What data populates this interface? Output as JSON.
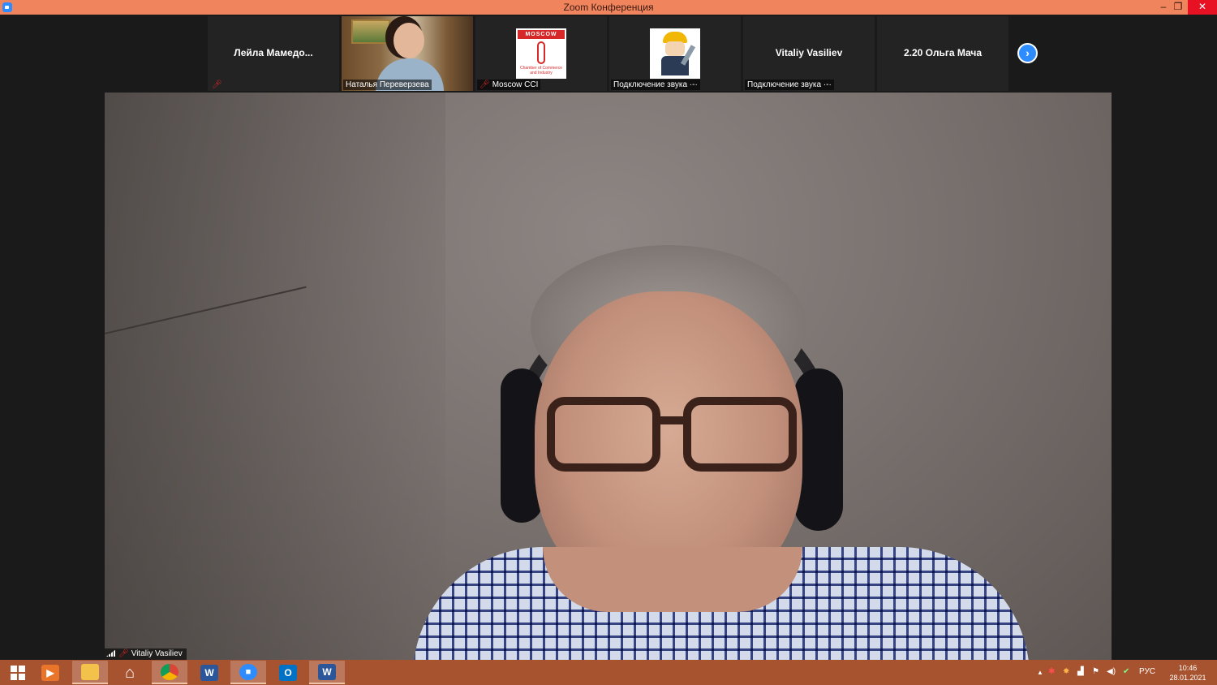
{
  "window": {
    "title": "Zoom Конференция",
    "controls": {
      "minimize": "‒",
      "restore": "❐",
      "close": "✕"
    }
  },
  "participants": [
    {
      "name": "Лейла  Мамедо...",
      "footer": "",
      "muted": true,
      "type": "name-only"
    },
    {
      "name": "Наталья Переверзева",
      "footer": "Наталья Переверзева",
      "muted": false,
      "type": "video"
    },
    {
      "name": "Moscow CCI",
      "footer": "Moscow CCI",
      "muted": true,
      "type": "logo",
      "logo_text": "MOSCOW",
      "logo_caption": "Chamber of Commerce and Industry"
    },
    {
      "name": "",
      "footer": "Подключение звука ·-·",
      "muted": false,
      "type": "logo"
    },
    {
      "name": "Vitaliy Vasiliev",
      "footer": "Подключение звука ·-·",
      "muted": false,
      "type": "name-only"
    },
    {
      "name": "2.20 Ольга Мача",
      "footer": "",
      "muted": false,
      "type": "name-only"
    }
  ],
  "next_page_icon": "›",
  "active_speaker": {
    "name": "Vitaliy Vasiliev",
    "muted": true
  },
  "taskbar": {
    "apps": [
      "windows-start",
      "media-player",
      "file-explorer",
      "home",
      "chrome",
      "word",
      "zoom",
      "outlook",
      "word"
    ],
    "tray": {
      "language": "РУС",
      "time": "10:46",
      "date": "28.01.2021",
      "overflow_arrow": "▲"
    }
  },
  "colors": {
    "titlebar": "#f0845c",
    "taskbar": "#a8532f",
    "zoom_blue": "#2d8cff",
    "mute_red": "#e02828"
  }
}
